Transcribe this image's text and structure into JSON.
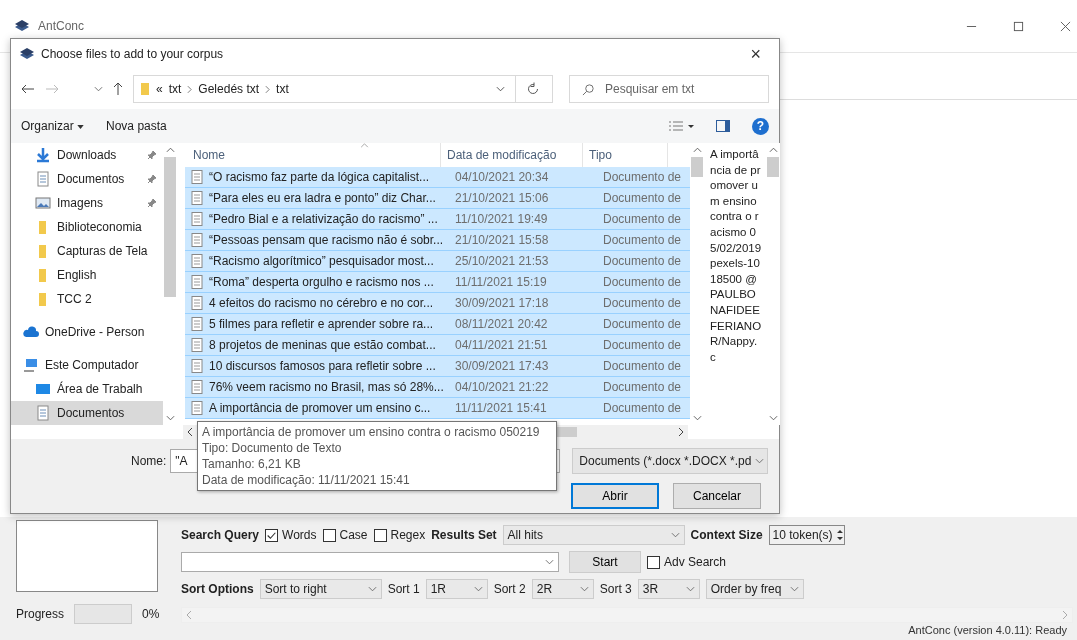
{
  "app_window": {
    "title": "AntConc"
  },
  "dialog": {
    "title": "Choose files to add to your corpus",
    "close": "×",
    "address": {
      "overflow_mark": "«",
      "crumbs": [
        "txt",
        "Geledés txt",
        "txt"
      ]
    },
    "search": {
      "placeholder": "Pesquisar em txt"
    },
    "toolbar": {
      "organize": "Organizar",
      "new_folder": "Nova pasta",
      "help": "?"
    },
    "nav_pane": {
      "items": [
        {
          "label": "Downloads",
          "kind": "download",
          "pinned": true,
          "selected": false
        },
        {
          "label": "Documentos",
          "kind": "document",
          "pinned": true,
          "selected": false
        },
        {
          "label": "Imagens",
          "kind": "image",
          "pinned": true,
          "selected": false
        },
        {
          "label": "Biblioteconomia",
          "kind": "folder",
          "pinned": false,
          "selected": false
        },
        {
          "label": "Capturas de Tela",
          "kind": "folder",
          "pinned": false,
          "selected": false
        },
        {
          "label": "English",
          "kind": "folder",
          "pinned": false,
          "selected": false
        },
        {
          "label": "TCC 2",
          "kind": "folder",
          "pinned": false,
          "selected": false
        },
        {
          "label": "OneDrive - Person",
          "kind": "cloud",
          "pinned": false,
          "selected": false
        },
        {
          "label": "Este Computador",
          "kind": "computer",
          "pinned": false,
          "selected": false,
          "children": [
            {
              "label": "Área de Trabalh",
              "kind": "desktop",
              "pinned": false,
              "selected": false
            },
            {
              "label": "Documentos",
              "kind": "document",
              "pinned": false,
              "selected": true
            }
          ]
        }
      ]
    },
    "file_list": {
      "columns": [
        "Nome",
        "Data de modificação",
        "Tipo"
      ],
      "rows": [
        {
          "name": "“O racismo faz parte da lógica capitalist...",
          "modified": "04/10/2021 20:34",
          "type": "Documento de",
          "selected": true
        },
        {
          "name": "“Para eles eu era ladra e ponto”  diz Char...",
          "modified": "21/10/2021 15:06",
          "type": "Documento de",
          "selected": true
        },
        {
          "name": "“Pedro Bial e a relativização do racismo” ...",
          "modified": "11/10/2021 19:49",
          "type": "Documento de",
          "selected": true
        },
        {
          "name": "“Pessoas pensam que racismo não é sobr...",
          "modified": "21/10/2021 15:58",
          "type": "Documento de",
          "selected": true
        },
        {
          "name": "“Racismo algorítmico” pesquisador most...",
          "modified": "25/10/2021 21:53",
          "type": "Documento de",
          "selected": true
        },
        {
          "name": "“Roma” desperta orgulho e racismo nos ...",
          "modified": "11/11/2021 15:19",
          "type": "Documento de",
          "selected": true
        },
        {
          "name": "4 efeitos do racismo no cérebro e no cor...",
          "modified": "30/09/2021 17:18",
          "type": "Documento de",
          "selected": true
        },
        {
          "name": "5 filmes para refletir e aprender sobre ra...",
          "modified": "08/11/2021 20:42",
          "type": "Documento de",
          "selected": true
        },
        {
          "name": "8 projetos de meninas que estão combat...",
          "modified": "04/11/2021 21:51",
          "type": "Documento de",
          "selected": true
        },
        {
          "name": "10 discursos famosos para refletir sobre ...",
          "modified": "30/09/2021 17:43",
          "type": "Documento de",
          "selected": true
        },
        {
          "name": "76% veem racismo no Brasil, mas só 28%...",
          "modified": "04/10/2021 21:22",
          "type": "Documento de",
          "selected": true
        },
        {
          "name": "A importância de promover um ensino c...",
          "modified": "11/11/2021 15:41",
          "type": "Documento de",
          "selected": true
        }
      ]
    },
    "preview": {
      "text": "A importância de promover um ensino contra o racismo 05/02/2019 pexels-1018500 @PAULBONAFIDEEFERIANOR/Nappy.c"
    },
    "tooltip": {
      "lines": [
        "A importância de promover um ensino contra o racismo 050219",
        "Tipo: Documento de Texto",
        "Tamanho: 6,21 KB",
        "Data de modificação: 11/11/2021 15:41"
      ]
    },
    "file_name": {
      "label": "Nome:",
      "value": "\"A"
    },
    "filter": {
      "value": "Documents (*.docx *.DOCX *.pd"
    },
    "buttons": [
      {
        "label": "Abrir",
        "default": true
      },
      {
        "label": "Cancelar",
        "default": false
      }
    ]
  },
  "search_panel": {
    "query_label": "Search Query",
    "options": [
      {
        "label": "Words",
        "checked": true
      },
      {
        "label": "Case",
        "checked": false
      },
      {
        "label": "Regex",
        "checked": false
      }
    ],
    "results_set": {
      "label": "Results Set",
      "value": "All hits"
    },
    "context_size": {
      "label": "Context Size",
      "value": "10 token(s)"
    },
    "start": "Start",
    "adv_search": {
      "label": "Adv Search",
      "checked": false
    },
    "sort_label": "Sort Options",
    "sort_value": "Sort to right",
    "sorts": [
      {
        "label": "Sort 1",
        "value": "1R"
      },
      {
        "label": "Sort 2",
        "value": "2R"
      },
      {
        "label": "Sort 3",
        "value": "3R"
      }
    ],
    "order": "Order by freq"
  },
  "progress": {
    "label": "Progress",
    "level": 0,
    "reading": "0%"
  },
  "status_bar": "AntConc (version 4.0.11): Ready"
}
